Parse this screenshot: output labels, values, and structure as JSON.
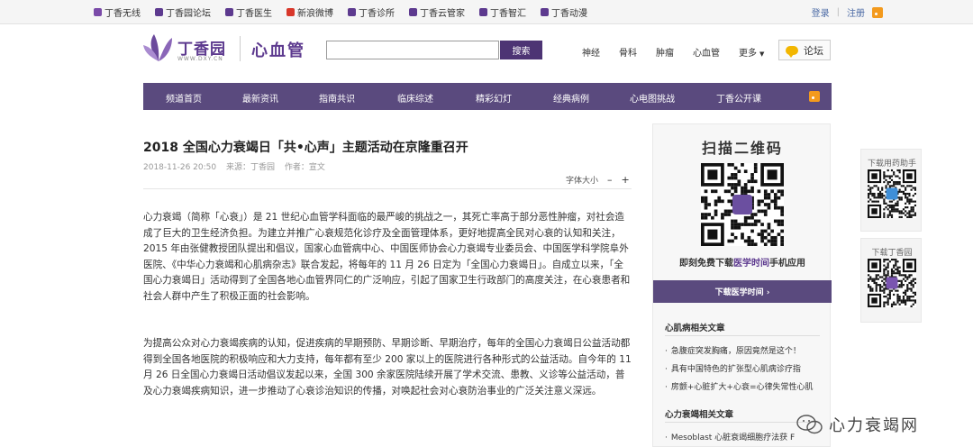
{
  "topbar": {
    "links": [
      {
        "label": "丁香无线",
        "color": "#7a4aa8",
        "icon": "phone-icon"
      },
      {
        "label": "丁香园论坛",
        "color": "#5d3a8f",
        "icon": "flower-icon"
      },
      {
        "label": "丁香医生",
        "color": "#5d3a8f",
        "icon": "plus-circle-icon"
      },
      {
        "label": "新浪微博",
        "color": "#d8372a",
        "icon": "weibo-icon"
      },
      {
        "label": "丁香诊所",
        "color": "#5d3a8f",
        "icon": "clinic-icon"
      },
      {
        "label": "丁香云管家",
        "color": "#5d3a8f",
        "icon": "cloud-icon"
      },
      {
        "label": "丁香智汇",
        "color": "#5d3a8f",
        "icon": "smart-icon"
      },
      {
        "label": "丁香动漫",
        "color": "#5d3a8f",
        "icon": "anime-icon"
      }
    ],
    "login": "登录",
    "register": "注册"
  },
  "header": {
    "logo_name": "丁香园",
    "logo_url": "WWW.DXY.CN",
    "channel": "心血管",
    "search_value": "",
    "search_button": "搜索",
    "nav": [
      "神经",
      "骨科",
      "肿瘤",
      "心血管"
    ],
    "more": "更多",
    "forum": "论坛"
  },
  "mainnav": [
    "频道首页",
    "最新资讯",
    "指南共识",
    "临床综述",
    "精彩幻灯",
    "经典病例",
    "心电图挑战",
    "丁香公开课"
  ],
  "article": {
    "title": "2018 全国心力衰竭日「共•心声」主题活动在京隆重召开",
    "date": "2018-11-26 20:50",
    "source": "来源：丁香园",
    "author": "作者：宣文",
    "font_size_label": "字体大小",
    "font_minus": "–",
    "font_plus": "+",
    "para1": "心力衰竭（简称「心衰」）是 21 世纪心血管学科面临的最严峻的挑战之一，其死亡率高于部分恶性肿瘤，对社会造成了巨大的卫生经济负担。为建立并推广心衰规范化诊疗及全面管理体系，更好地提高全民对心衰的认知和关注，2015 年由张健教授团队提出和倡议，国家心血管病中心、中国医师协会心力衰竭专业委员会、中国医学科学院阜外医院、《中华心力衰竭和心肌病杂志》联合发起，将每年的 11 月 26 日定为「全国心力衰竭日」。自成立以来，「全国心力衰竭日」活动得到了全国各地心血管界同仁的广泛响应，引起了国家卫生行政部门的高度关注，在心衰患者和社会人群中产生了积极正面的社会影响。",
    "para2": "为提高公众对心力衰竭疾病的认知，促进疾病的早期预防、早期诊断、早期治疗，每年的全国心力衰竭日公益活动都得到全国各地医院的积极响应和大力支持，每年都有至少 200 家以上的医院进行各种形式的公益活动。自今年的 11 月 26 日全国心力衰竭日活动倡议发起以来，全国 300 余家医院陆续开展了学术交流、患教、义诊等公益活动，普及心力衰竭疾病知识，进一步推动了心衰诊治知识的传播，对唤起社会对心衰防治事业的广泛关注意义深远。"
  },
  "sidebar": {
    "scan_title": "扫描二维码",
    "desc_pre": "即刻免费下载",
    "desc_highlight": "医学时间",
    "desc_post": "手机应用",
    "download_button": "下载医学时间 ›",
    "section1_title": "心肌病相关文章",
    "section1_items": [
      "急腹症突发胸痛，原因竟然是这个！",
      "具有中国特色的扩张型心肌病诊疗指",
      "房颤+心脏扩大+心衰=心律失常性心肌"
    ],
    "section2_title": "心力衰竭相关文章",
    "section2_items": [
      "Mesoblast 心脏衰竭细胞疗法获 F"
    ]
  },
  "widgets": {
    "drug_label": "下载用药助手",
    "app_label": "下载丁香园"
  },
  "watermark": "心力衰竭网",
  "colors": {
    "brand": "#5d3a8f",
    "nav_bg": "#5a4a7e",
    "rss": "#f39a1d"
  }
}
